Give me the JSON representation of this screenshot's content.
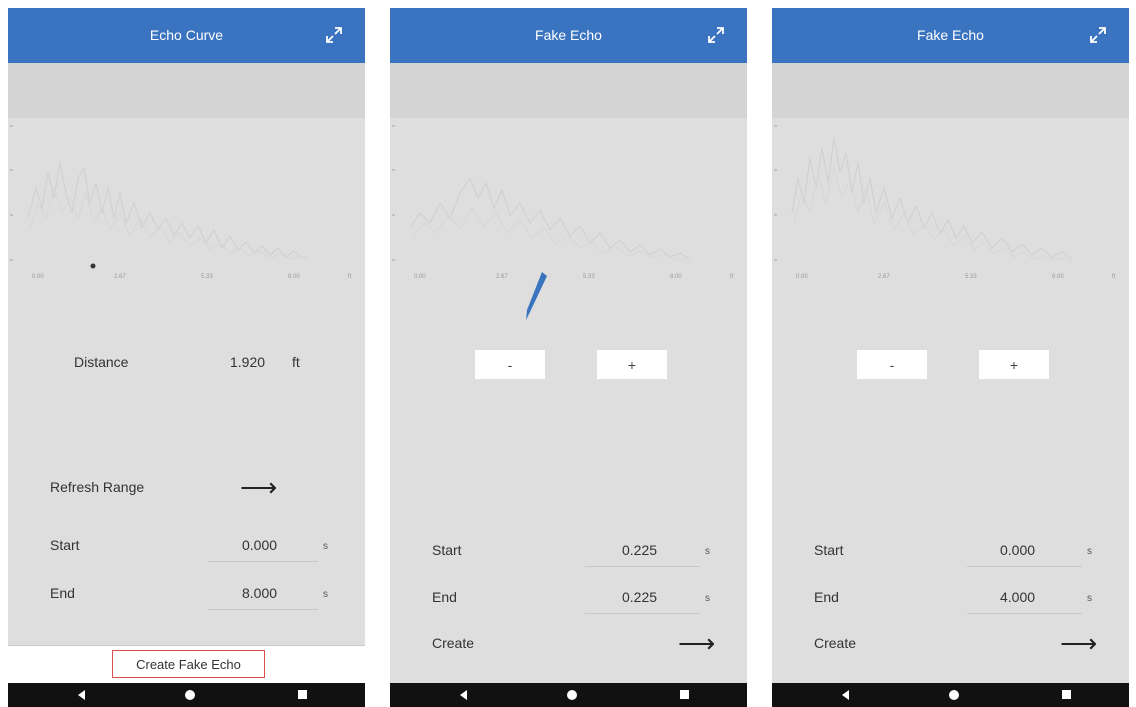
{
  "accent": "#3a73c0",
  "highlight": "#d94f4f",
  "panel1": {
    "title": "Echo Curve",
    "expand_icon": "expand-icon",
    "chart": {
      "y_ticks": [
        "≈",
        "≈",
        "≈",
        "≈"
      ],
      "x_ticks": [
        "0.00",
        "2.67",
        "5.33",
        "8.00",
        "ft"
      ]
    },
    "distance_label": "Distance",
    "distance_value": "1.920",
    "distance_unit": "ft",
    "refresh_label": "Refresh Range",
    "start_label": "Start",
    "start_value": "0.000",
    "start_unit": "s",
    "end_label": "End",
    "end_value": "8.000",
    "end_unit": "s",
    "create_fake_label": "Create Fake Echo"
  },
  "panel2": {
    "title": "Fake Echo",
    "chart": {
      "y_ticks": [
        "≈",
        "≈",
        "≈",
        "≈"
      ],
      "x_ticks": [
        "0.00",
        "2.67",
        "5.33",
        "8.00",
        "ft"
      ]
    },
    "minus_label": "-",
    "plus_label": "+",
    "start_label": "Start",
    "start_value": "0.225",
    "start_unit": "s",
    "end_label": "End",
    "end_value": "0.225",
    "end_unit": "s",
    "create_label": "Create"
  },
  "panel3": {
    "title": "Fake Echo",
    "chart": {
      "y_ticks": [
        "≈",
        "≈",
        "≈",
        "≈"
      ],
      "x_ticks": [
        "0.00",
        "2.67",
        "5.33",
        "8.00",
        "ft"
      ]
    },
    "minus_label": "-",
    "plus_label": "+",
    "start_label": "Start",
    "start_value": "0.000",
    "start_unit": "s",
    "end_label": "End",
    "end_value": "4.000",
    "end_unit": "s",
    "create_label": "Create"
  }
}
